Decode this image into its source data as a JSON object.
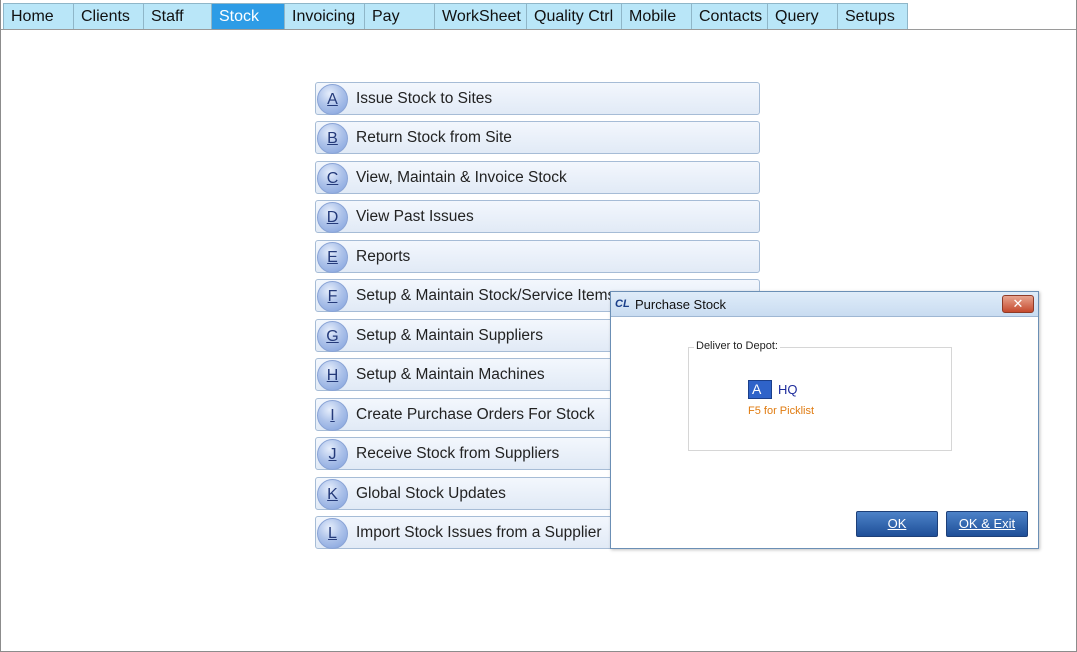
{
  "tabs": [
    {
      "label": "Home",
      "active": false
    },
    {
      "label": "Clients",
      "active": false
    },
    {
      "label": "Staff",
      "active": false
    },
    {
      "label": "Stock",
      "active": true
    },
    {
      "label": "Invoicing",
      "active": false
    },
    {
      "label": "Pay",
      "active": false
    },
    {
      "label": "WorkSheet",
      "active": false
    },
    {
      "label": "Quality Ctrl",
      "active": false
    },
    {
      "label": "Mobile",
      "active": false
    },
    {
      "label": "Contacts",
      "active": false
    },
    {
      "label": "Query",
      "active": false
    },
    {
      "label": "Setups",
      "active": false
    }
  ],
  "menu": [
    {
      "key": "A",
      "label": "Issue Stock to Sites"
    },
    {
      "key": "B",
      "label": "Return Stock from Site"
    },
    {
      "key": "C",
      "label": "View, Maintain & Invoice Stock"
    },
    {
      "key": "D",
      "label": "View Past Issues"
    },
    {
      "key": "E",
      "label": "Reports"
    },
    {
      "key": "F",
      "label": "Setup & Maintain Stock/Service Items"
    },
    {
      "key": "G",
      "label": "Setup & Maintain Suppliers"
    },
    {
      "key": "H",
      "label": "Setup & Maintain Machines"
    },
    {
      "key": "I",
      "label": "Create Purchase Orders For Stock"
    },
    {
      "key": "J",
      "label": "Receive Stock from Suppliers"
    },
    {
      "key": "K",
      "label": "Global Stock Updates"
    },
    {
      "key": "L",
      "label": "Import Stock Issues from a Supplier"
    }
  ],
  "dialog": {
    "icon_text": "CL",
    "title": "Purchase Stock",
    "close_label": "✕",
    "group_label": "Deliver to Depot:",
    "depot_code": "A",
    "depot_name": "HQ",
    "hint": "F5 for Picklist",
    "ok_label": "OK",
    "ok_exit_label": "OK & Exit"
  },
  "colors": {
    "tab_bg": "#b9e6f8",
    "tab_active_bg": "#2d9ce6",
    "button_bg": "#e8eff9",
    "dialog_button_bg": "#2a5fa8",
    "hint_color": "#e07b10"
  }
}
